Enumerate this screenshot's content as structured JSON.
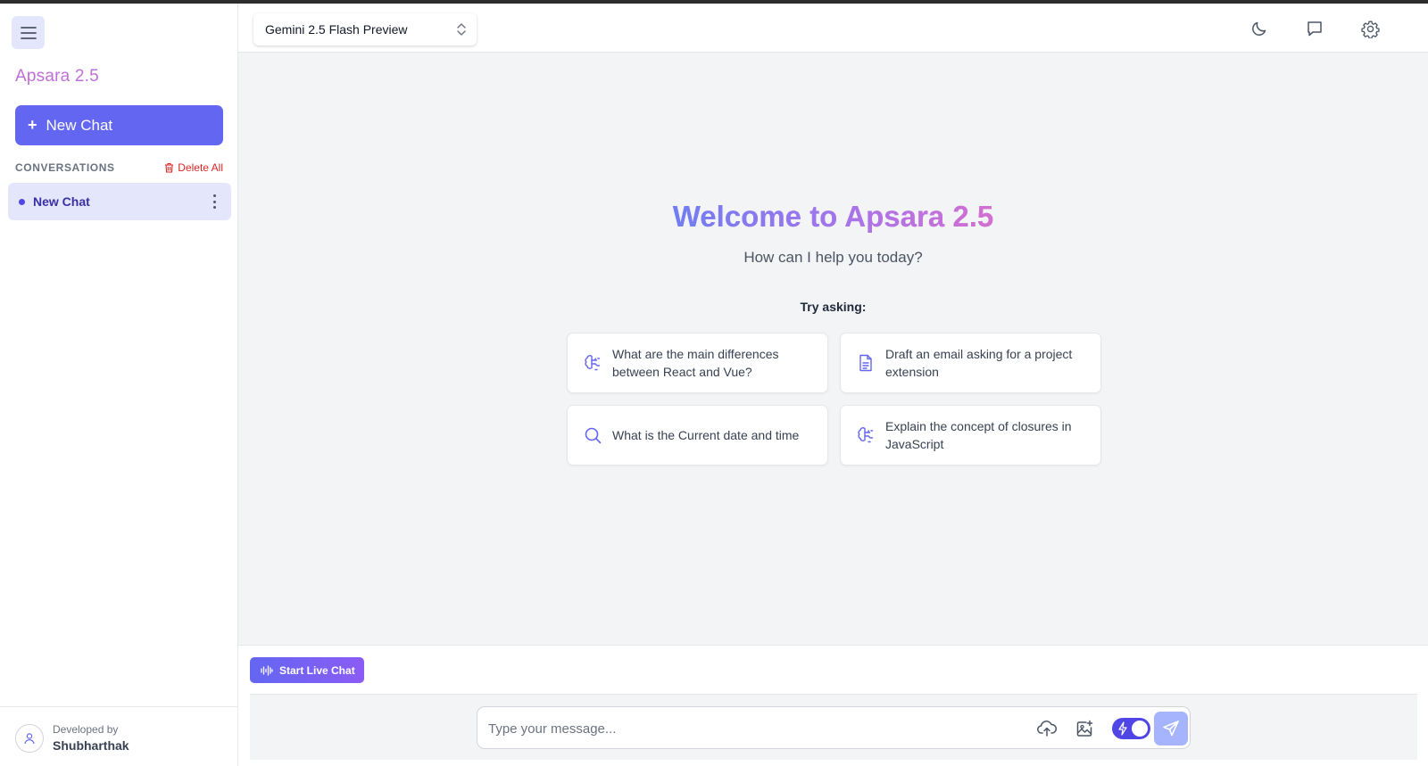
{
  "sidebar": {
    "brand": "Apsara 2.5",
    "new_chat_label": "New Chat",
    "conversations_title": "CONVERSATIONS",
    "delete_all_label": "Delete All",
    "conversations": [
      {
        "label": "New Chat",
        "active": true
      }
    ],
    "footer": {
      "developed_by": "Developed by",
      "developer": "Shubharthak"
    }
  },
  "header": {
    "model_selected": "Gemini 2.5 Flash Preview",
    "icons": [
      "moon-icon",
      "chat-bubble-icon",
      "gear-icon"
    ]
  },
  "main": {
    "welcome_title": "Welcome to Apsara 2.5",
    "subtitle": "How can I help you today?",
    "try_asking": "Try asking:",
    "suggestions": [
      {
        "text": "What are the main differences between React and Vue?",
        "icon": "brain-icon"
      },
      {
        "text": "Draft an email asking for a project extension",
        "icon": "document-icon"
      },
      {
        "text": "What is the Current date and time",
        "icon": "search-icon"
      },
      {
        "text": "Explain the concept of closures in JavaScript",
        "icon": "brain-icon"
      }
    ]
  },
  "composer": {
    "live_chat_label": "Start Live Chat",
    "placeholder": "Type your message...",
    "value": "",
    "fast_mode_on": true
  },
  "colors": {
    "accent": "#6366f1",
    "brand_text": "#c06fd6",
    "danger": "#dc2626"
  }
}
